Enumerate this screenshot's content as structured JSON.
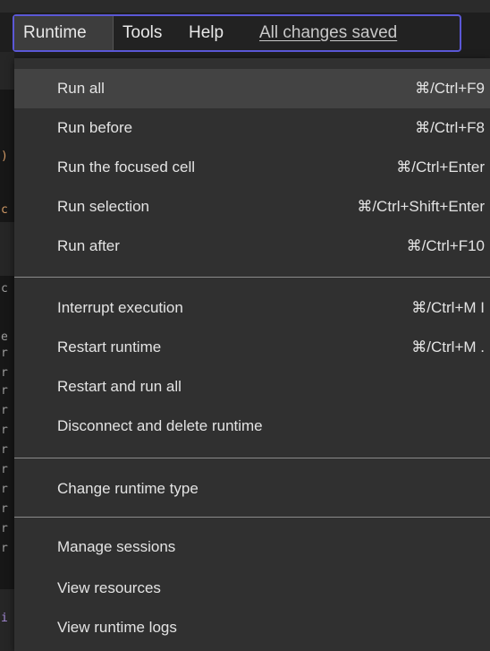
{
  "menubar": {
    "items": [
      {
        "label": "Runtime"
      },
      {
        "label": "Tools"
      },
      {
        "label": "Help"
      }
    ],
    "status": "All changes saved"
  },
  "runtime_menu": {
    "groups": [
      [
        {
          "label": "Run all",
          "shortcut": "⌘/Ctrl+F9"
        },
        {
          "label": "Run before",
          "shortcut": "⌘/Ctrl+F8"
        },
        {
          "label": "Run the focused cell",
          "shortcut": "⌘/Ctrl+Enter"
        },
        {
          "label": "Run selection",
          "shortcut": "⌘/Ctrl+Shift+Enter"
        },
        {
          "label": "Run after",
          "shortcut": "⌘/Ctrl+F10"
        }
      ],
      [
        {
          "label": "Interrupt execution",
          "shortcut": "⌘/Ctrl+M I"
        },
        {
          "label": "Restart runtime",
          "shortcut": "⌘/Ctrl+M ."
        },
        {
          "label": "Restart and run all",
          "shortcut": ""
        },
        {
          "label": "Disconnect and delete runtime",
          "shortcut": ""
        }
      ],
      [
        {
          "label": "Change runtime type",
          "shortcut": ""
        }
      ],
      [
        {
          "label": "Manage sessions",
          "shortcut": ""
        },
        {
          "label": "View resources",
          "shortcut": ""
        },
        {
          "label": "View runtime logs",
          "shortcut": ""
        }
      ]
    ]
  },
  "colors": {
    "menubar_focus_border": "#5b58d6",
    "menu_background": "#303030",
    "hover_background": "#434343",
    "text": "#e3e3e3"
  }
}
